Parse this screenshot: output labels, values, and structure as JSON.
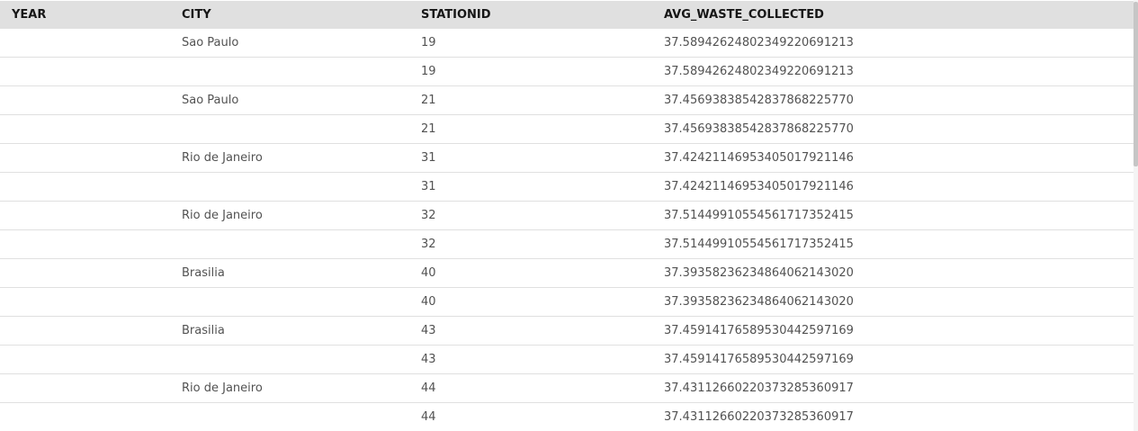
{
  "table": {
    "columns": [
      "YEAR",
      "CITY",
      "STATIONID",
      "AVG_WASTE_COLLECTED"
    ],
    "rows": [
      {
        "year": "",
        "city": "Sao Paulo",
        "stationid": "19",
        "avg": "37.58942624802349220691213"
      },
      {
        "year": "",
        "city": "",
        "stationid": "19",
        "avg": "37.58942624802349220691213"
      },
      {
        "year": "",
        "city": "Sao Paulo",
        "stationid": "21",
        "avg": "37.45693838542837868225770"
      },
      {
        "year": "",
        "city": "",
        "stationid": "21",
        "avg": "37.45693838542837868225770"
      },
      {
        "year": "",
        "city": "Rio de Janeiro",
        "stationid": "31",
        "avg": "37.42421146953405017921146"
      },
      {
        "year": "",
        "city": "",
        "stationid": "31",
        "avg": "37.42421146953405017921146"
      },
      {
        "year": "",
        "city": "Rio de Janeiro",
        "stationid": "32",
        "avg": "37.51449910554561717352415"
      },
      {
        "year": "",
        "city": "",
        "stationid": "32",
        "avg": "37.51449910554561717352415"
      },
      {
        "year": "",
        "city": "Brasilia",
        "stationid": "40",
        "avg": "37.39358236234864062143020"
      },
      {
        "year": "",
        "city": "",
        "stationid": "40",
        "avg": "37.39358236234864062143020"
      },
      {
        "year": "",
        "city": "Brasilia",
        "stationid": "43",
        "avg": "37.45914176589530442597169"
      },
      {
        "year": "",
        "city": "",
        "stationid": "43",
        "avg": "37.45914176589530442597169"
      },
      {
        "year": "",
        "city": "Rio de Janeiro",
        "stationid": "44",
        "avg": "37.43112660220373285360917"
      },
      {
        "year": "",
        "city": "",
        "stationid": "44",
        "avg": "37.43112660220373285360917"
      }
    ]
  },
  "colors": {
    "header_bg": "#e0e0e0",
    "row_border": "#e0e0e0",
    "cell_text": "#525252",
    "header_text": "#161616"
  }
}
